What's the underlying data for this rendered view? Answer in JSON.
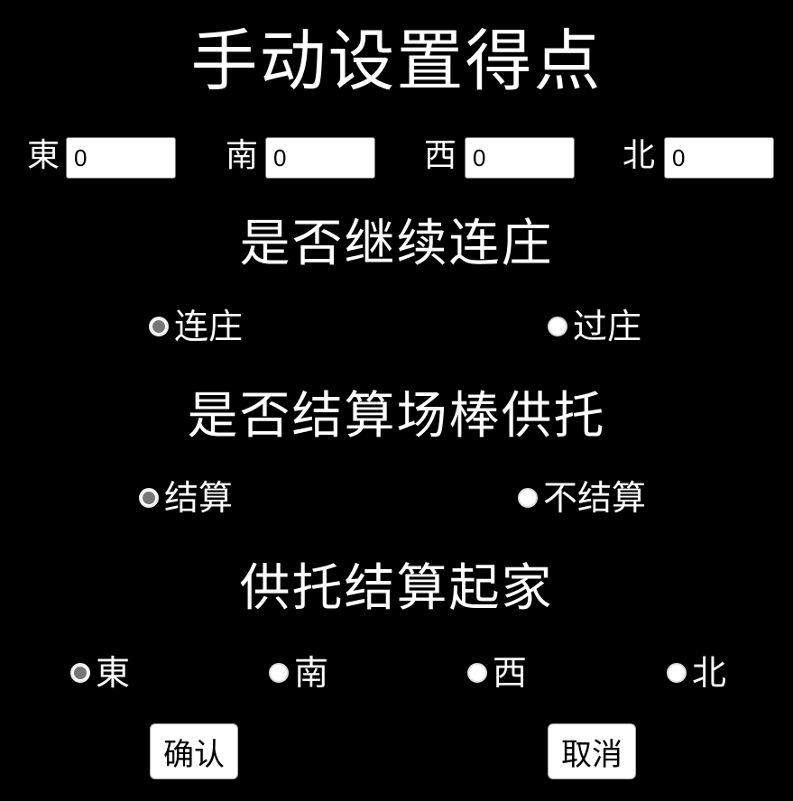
{
  "title": "手动设置得点",
  "scores": [
    {
      "label": "東",
      "value": "0"
    },
    {
      "label": "南",
      "value": "0"
    },
    {
      "label": "西",
      "value": "0"
    },
    {
      "label": "北",
      "value": "0"
    }
  ],
  "renchan": {
    "title": "是否继续连庄",
    "options": [
      {
        "label": "连庄",
        "checked": true
      },
      {
        "label": "过庄",
        "checked": false
      }
    ]
  },
  "settle": {
    "title": "是否结算场棒供托",
    "options": [
      {
        "label": "结算",
        "checked": true
      },
      {
        "label": "不结算",
        "checked": false
      }
    ]
  },
  "start_seat": {
    "title": "供托结算起家",
    "options": [
      {
        "label": "東",
        "checked": true
      },
      {
        "label": "南",
        "checked": false
      },
      {
        "label": "西",
        "checked": false
      },
      {
        "label": "北",
        "checked": false
      }
    ]
  },
  "buttons": {
    "confirm": "确认",
    "cancel": "取消"
  }
}
